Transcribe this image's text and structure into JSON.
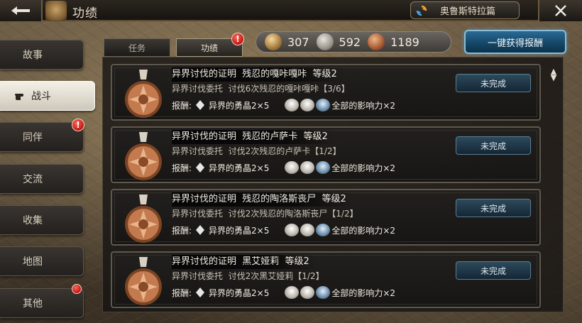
{
  "header": {
    "title": "功绩",
    "scenario": "奥鲁斯特拉篇"
  },
  "sidebar": {
    "items": [
      {
        "label": "故事",
        "active": false,
        "badge": false
      },
      {
        "label": "战斗",
        "active": true,
        "badge": false
      },
      {
        "label": "同伴",
        "active": false,
        "badge": true
      },
      {
        "label": "交流",
        "active": false,
        "badge": false
      },
      {
        "label": "收集",
        "active": false,
        "badge": false
      },
      {
        "label": "地图",
        "active": false,
        "badge": false
      },
      {
        "label": "其他",
        "active": false,
        "badge": true
      }
    ]
  },
  "tabs": [
    {
      "label": "任务",
      "active": false
    },
    {
      "label": "功绩",
      "active": true,
      "badge": true
    }
  ],
  "badge_glyph": "!",
  "currency": {
    "gold": "307",
    "silver": "592",
    "bronze": "1189"
  },
  "claim_all_label": "一键获得报酬",
  "missions": [
    {
      "title": "异界讨伐的证明  残忍的嘎咔嘎咔  等级2",
      "desc": "异界讨伐委托  讨伐6次残忍的嘎咔嘎咔【3/6】",
      "reward_label": "报酬:",
      "reward_item": "异界的勇晶2×5",
      "influence": "全部的影响力×2",
      "status": "未完成"
    },
    {
      "title": "异界讨伐的证明  残忍的卢萨卡  等级2",
      "desc": "异界讨伐委托  讨伐2次残忍的卢萨卡【1/2】",
      "reward_label": "报酬:",
      "reward_item": "异界的勇晶2×5",
      "influence": "全部的影响力×2",
      "status": "未完成"
    },
    {
      "title": "异界讨伐的证明  残忍的陶洛斯丧尸  等级2",
      "desc": "异界讨伐委托  讨伐2次残忍的陶洛斯丧尸【1/2】",
      "reward_label": "报酬:",
      "reward_item": "异界的勇晶2×5",
      "influence": "全部的影响力×2",
      "status": "未完成"
    },
    {
      "title": "异界讨伐的证明  黑艾娅莉  等级2",
      "desc": "异界讨伐委托  讨伐2次黑艾娅莉【1/2】",
      "reward_label": "报酬:",
      "reward_item": "异界的勇晶2×5",
      "influence": "全部的影响力×2",
      "status": "未完成"
    }
  ],
  "colors": {
    "claim_button": "#154868",
    "badge_red": "#c01414",
    "status_button": "#2d4a5c"
  }
}
